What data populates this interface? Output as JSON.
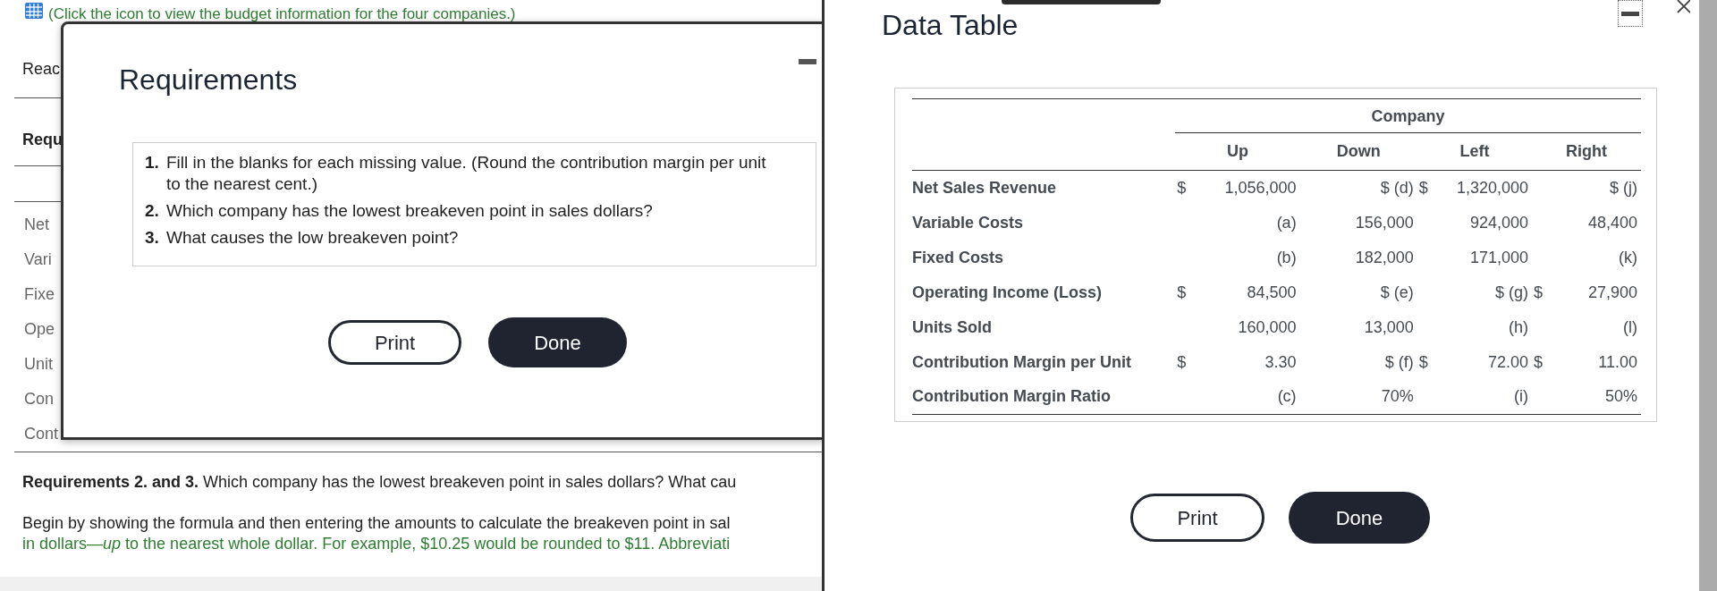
{
  "background": {
    "link": "(Click the icon to view the budget information for the four companies.)",
    "tab_fragment": "Reac",
    "section_heading": "Requ",
    "row_labels": [
      "Net",
      "Vari",
      "Fixe",
      "Ope",
      "Unit",
      "Con",
      "Cont"
    ],
    "requirements_line": "**Requirements 2. and 3.** Which company has the lowest breakeven point in sales dollars? What cau",
    "instruction": "Begin by showing the formula and then entering the amounts to calculate the breakeven point in sal",
    "hint": "in dollars—*up* to the nearest whole dollar. For example, $10.25 would be rounded to $11. Abbreviati"
  },
  "requirements_dialog": {
    "title": "Requirements",
    "items": [
      {
        "number": "1.",
        "text": "Fill in the blanks for each missing value. (Round the contribution margin per unit to the nearest cent.)"
      },
      {
        "number": "2.",
        "text": "Which company has the lowest breakeven point in sales dollars?"
      },
      {
        "number": "3.",
        "text": "What causes the low breakeven point?"
      }
    ],
    "buttons": [
      {
        "label": "Print",
        "kind": "outline"
      },
      {
        "label": "Done",
        "kind": "filled"
      }
    ]
  },
  "data_table": {
    "title": "Data Table",
    "group_header": "Company",
    "columns": [
      "Up",
      "Down",
      "Left",
      "Right"
    ],
    "rows": [
      {
        "label": "Net Sales Revenue",
        "cells": [
          {
            "sign": "$",
            "value": "1,056,000"
          },
          {
            "value": "$ (d)"
          },
          {
            "sign": "$",
            "value": "1,320,000"
          },
          {
            "value": "$ (j)"
          }
        ]
      },
      {
        "label": "Variable Costs",
        "cells": [
          {
            "value": "(a)"
          },
          {
            "value": "156,000"
          },
          {
            "value": "924,000"
          },
          {
            "value": "48,400"
          }
        ]
      },
      {
        "label": "Fixed Costs",
        "cells": [
          {
            "value": "(b)"
          },
          {
            "value": "182,000"
          },
          {
            "value": "171,000"
          },
          {
            "value": "(k)"
          }
        ]
      },
      {
        "label": "Operating Income (Loss)",
        "cells": [
          {
            "sign": "$",
            "value": "84,500"
          },
          {
            "value": "$ (e)"
          },
          {
            "value": "$ (g)"
          },
          {
            "sign": "$",
            "value": "27,900"
          }
        ]
      },
      {
        "label": "Units Sold",
        "cells": [
          {
            "value": "160,000"
          },
          {
            "value": "13,000"
          },
          {
            "value": "(h)"
          },
          {
            "value": "(l)"
          }
        ]
      },
      {
        "label": "Contribution Margin per Unit",
        "cells": [
          {
            "sign": "$",
            "value": "3.30"
          },
          {
            "value": "$ (f)"
          },
          {
            "sign": "$",
            "value": "72.00"
          },
          {
            "sign": "$",
            "value": "11.00"
          }
        ]
      },
      {
        "label": "Contribution Margin Ratio",
        "cells": [
          {
            "value": "(c)"
          },
          {
            "value": "70%"
          },
          {
            "value": "(i)"
          },
          {
            "value": "50%"
          }
        ]
      }
    ],
    "buttons": [
      {
        "label": "Print",
        "kind": "outline"
      },
      {
        "label": "Done",
        "kind": "filled"
      }
    ]
  }
}
